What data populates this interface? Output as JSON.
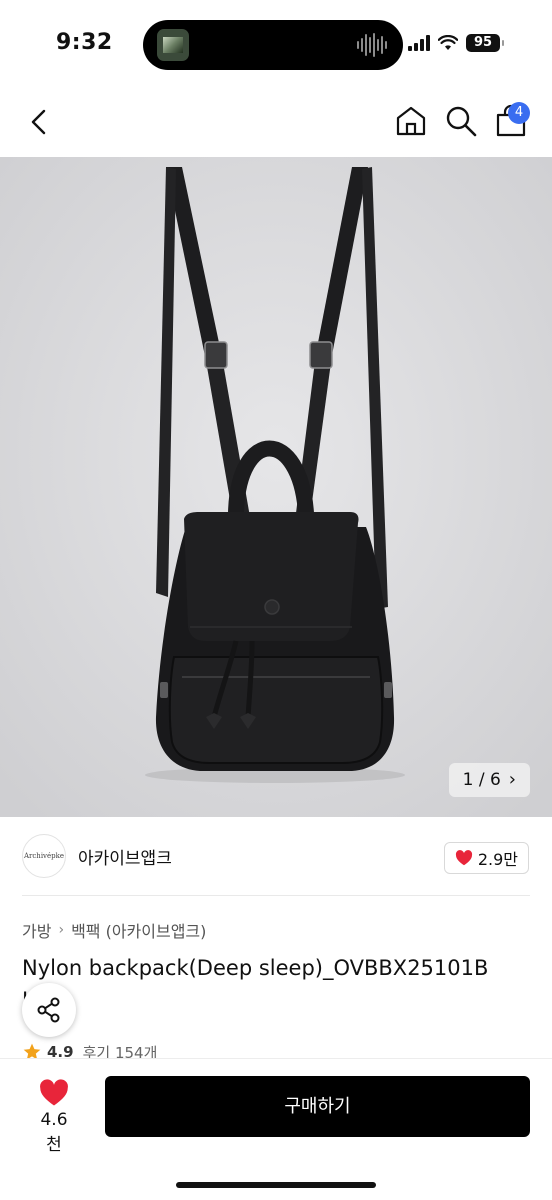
{
  "status": {
    "time": "9:32",
    "battery": "95"
  },
  "nav": {
    "cart_count": "4"
  },
  "gallery": {
    "counter": "1 / 6"
  },
  "brand": {
    "name": "아카이브앱크",
    "logo_text": "Archivépke",
    "likes": "2.9만"
  },
  "breadcrumb": {
    "level1": "가방",
    "level2": "백팩 (아카이브앱크)"
  },
  "product": {
    "title": "Nylon backpack(Deep sleep)_OVBBX25101B",
    "title_line2": "L"
  },
  "rating": {
    "score": "4.9",
    "reviews": "후기 154개"
  },
  "bottom": {
    "wish_count": "4.6천",
    "buy_label": "구매하기"
  },
  "colors": {
    "accent_blue": "#3a6df0",
    "heart_red": "#e8253a",
    "primary_black": "#000000"
  }
}
